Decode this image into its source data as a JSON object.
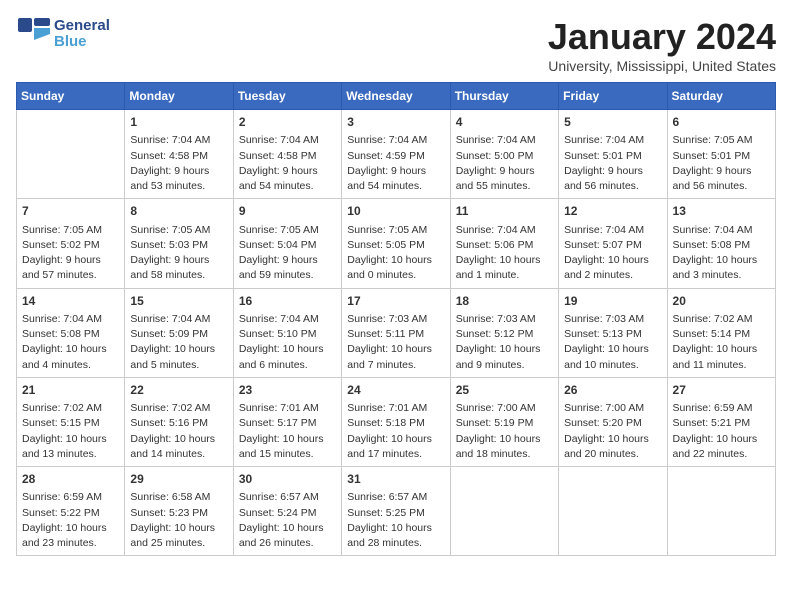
{
  "logo": {
    "line1": "General",
    "line2": "Blue"
  },
  "title": "January 2024",
  "subtitle": "University, Mississippi, United States",
  "weekdays": [
    "Sunday",
    "Monday",
    "Tuesday",
    "Wednesday",
    "Thursday",
    "Friday",
    "Saturday"
  ],
  "weeks": [
    [
      {
        "day": "",
        "sunrise": "",
        "sunset": "",
        "daylight": ""
      },
      {
        "day": "1",
        "sunrise": "Sunrise: 7:04 AM",
        "sunset": "Sunset: 4:58 PM",
        "daylight": "Daylight: 9 hours and 53 minutes."
      },
      {
        "day": "2",
        "sunrise": "Sunrise: 7:04 AM",
        "sunset": "Sunset: 4:58 PM",
        "daylight": "Daylight: 9 hours and 54 minutes."
      },
      {
        "day": "3",
        "sunrise": "Sunrise: 7:04 AM",
        "sunset": "Sunset: 4:59 PM",
        "daylight": "Daylight: 9 hours and 54 minutes."
      },
      {
        "day": "4",
        "sunrise": "Sunrise: 7:04 AM",
        "sunset": "Sunset: 5:00 PM",
        "daylight": "Daylight: 9 hours and 55 minutes."
      },
      {
        "day": "5",
        "sunrise": "Sunrise: 7:04 AM",
        "sunset": "Sunset: 5:01 PM",
        "daylight": "Daylight: 9 hours and 56 minutes."
      },
      {
        "day": "6",
        "sunrise": "Sunrise: 7:05 AM",
        "sunset": "Sunset: 5:01 PM",
        "daylight": "Daylight: 9 hours and 56 minutes."
      }
    ],
    [
      {
        "day": "7",
        "sunrise": "Sunrise: 7:05 AM",
        "sunset": "Sunset: 5:02 PM",
        "daylight": "Daylight: 9 hours and 57 minutes."
      },
      {
        "day": "8",
        "sunrise": "Sunrise: 7:05 AM",
        "sunset": "Sunset: 5:03 PM",
        "daylight": "Daylight: 9 hours and 58 minutes."
      },
      {
        "day": "9",
        "sunrise": "Sunrise: 7:05 AM",
        "sunset": "Sunset: 5:04 PM",
        "daylight": "Daylight: 9 hours and 59 minutes."
      },
      {
        "day": "10",
        "sunrise": "Sunrise: 7:05 AM",
        "sunset": "Sunset: 5:05 PM",
        "daylight": "Daylight: 10 hours and 0 minutes."
      },
      {
        "day": "11",
        "sunrise": "Sunrise: 7:04 AM",
        "sunset": "Sunset: 5:06 PM",
        "daylight": "Daylight: 10 hours and 1 minute."
      },
      {
        "day": "12",
        "sunrise": "Sunrise: 7:04 AM",
        "sunset": "Sunset: 5:07 PM",
        "daylight": "Daylight: 10 hours and 2 minutes."
      },
      {
        "day": "13",
        "sunrise": "Sunrise: 7:04 AM",
        "sunset": "Sunset: 5:08 PM",
        "daylight": "Daylight: 10 hours and 3 minutes."
      }
    ],
    [
      {
        "day": "14",
        "sunrise": "Sunrise: 7:04 AM",
        "sunset": "Sunset: 5:08 PM",
        "daylight": "Daylight: 10 hours and 4 minutes."
      },
      {
        "day": "15",
        "sunrise": "Sunrise: 7:04 AM",
        "sunset": "Sunset: 5:09 PM",
        "daylight": "Daylight: 10 hours and 5 minutes."
      },
      {
        "day": "16",
        "sunrise": "Sunrise: 7:04 AM",
        "sunset": "Sunset: 5:10 PM",
        "daylight": "Daylight: 10 hours and 6 minutes."
      },
      {
        "day": "17",
        "sunrise": "Sunrise: 7:03 AM",
        "sunset": "Sunset: 5:11 PM",
        "daylight": "Daylight: 10 hours and 7 minutes."
      },
      {
        "day": "18",
        "sunrise": "Sunrise: 7:03 AM",
        "sunset": "Sunset: 5:12 PM",
        "daylight": "Daylight: 10 hours and 9 minutes."
      },
      {
        "day": "19",
        "sunrise": "Sunrise: 7:03 AM",
        "sunset": "Sunset: 5:13 PM",
        "daylight": "Daylight: 10 hours and 10 minutes."
      },
      {
        "day": "20",
        "sunrise": "Sunrise: 7:02 AM",
        "sunset": "Sunset: 5:14 PM",
        "daylight": "Daylight: 10 hours and 11 minutes."
      }
    ],
    [
      {
        "day": "21",
        "sunrise": "Sunrise: 7:02 AM",
        "sunset": "Sunset: 5:15 PM",
        "daylight": "Daylight: 10 hours and 13 minutes."
      },
      {
        "day": "22",
        "sunrise": "Sunrise: 7:02 AM",
        "sunset": "Sunset: 5:16 PM",
        "daylight": "Daylight: 10 hours and 14 minutes."
      },
      {
        "day": "23",
        "sunrise": "Sunrise: 7:01 AM",
        "sunset": "Sunset: 5:17 PM",
        "daylight": "Daylight: 10 hours and 15 minutes."
      },
      {
        "day": "24",
        "sunrise": "Sunrise: 7:01 AM",
        "sunset": "Sunset: 5:18 PM",
        "daylight": "Daylight: 10 hours and 17 minutes."
      },
      {
        "day": "25",
        "sunrise": "Sunrise: 7:00 AM",
        "sunset": "Sunset: 5:19 PM",
        "daylight": "Daylight: 10 hours and 18 minutes."
      },
      {
        "day": "26",
        "sunrise": "Sunrise: 7:00 AM",
        "sunset": "Sunset: 5:20 PM",
        "daylight": "Daylight: 10 hours and 20 minutes."
      },
      {
        "day": "27",
        "sunrise": "Sunrise: 6:59 AM",
        "sunset": "Sunset: 5:21 PM",
        "daylight": "Daylight: 10 hours and 22 minutes."
      }
    ],
    [
      {
        "day": "28",
        "sunrise": "Sunrise: 6:59 AM",
        "sunset": "Sunset: 5:22 PM",
        "daylight": "Daylight: 10 hours and 23 minutes."
      },
      {
        "day": "29",
        "sunrise": "Sunrise: 6:58 AM",
        "sunset": "Sunset: 5:23 PM",
        "daylight": "Daylight: 10 hours and 25 minutes."
      },
      {
        "day": "30",
        "sunrise": "Sunrise: 6:57 AM",
        "sunset": "Sunset: 5:24 PM",
        "daylight": "Daylight: 10 hours and 26 minutes."
      },
      {
        "day": "31",
        "sunrise": "Sunrise: 6:57 AM",
        "sunset": "Sunset: 5:25 PM",
        "daylight": "Daylight: 10 hours and 28 minutes."
      },
      {
        "day": "",
        "sunrise": "",
        "sunset": "",
        "daylight": ""
      },
      {
        "day": "",
        "sunrise": "",
        "sunset": "",
        "daylight": ""
      },
      {
        "day": "",
        "sunrise": "",
        "sunset": "",
        "daylight": ""
      }
    ]
  ]
}
